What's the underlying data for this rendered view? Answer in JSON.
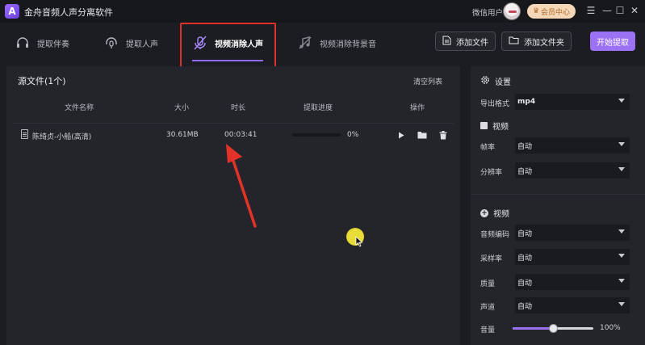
{
  "app": {
    "logo": "A",
    "title": "金舟音频人声分离软件",
    "user": "微信用户",
    "vip_label": "会员中心"
  },
  "window_controls": [
    "☰",
    "—",
    "☐",
    "✕"
  ],
  "tabs": [
    {
      "label": "提取伴奏",
      "icon": "headphones-icon"
    },
    {
      "label": "提取人声",
      "icon": "headphone-mic-icon"
    },
    {
      "label": "视频消除人声",
      "icon": "mute-mic-icon",
      "active": true
    },
    {
      "label": "视频消除背景音",
      "icon": "mute-music-icon"
    }
  ],
  "toolbar": {
    "add_file": "添加文件",
    "add_folder": "添加文件夹",
    "start": "开始提取"
  },
  "main": {
    "title": "源文件(1个)",
    "clear": "清空列表",
    "columns": {
      "name": "文件名称",
      "size": "大小",
      "duration": "时长",
      "progress": "提取进度",
      "actions": "操作"
    },
    "file": {
      "name": "陈绮贞-小船(高清)",
      "size": "30.61MB",
      "duration": "00:03:41",
      "progress_text": "0%",
      "progress": 0
    }
  },
  "settings": {
    "title": "设置",
    "export_format_label": "导出格式",
    "export_format": "mp4",
    "video_section": "视频",
    "frame_rate_label": "帧率",
    "frame_rate": "自动",
    "resolution_label": "分辨率",
    "resolution": "自动",
    "audio_section": "视频",
    "audio_codec_label": "音频编码",
    "audio_codec": "自动",
    "sample_rate_label": "采样率",
    "sample_rate": "自动",
    "quality_label": "质量",
    "quality": "自动",
    "channel_label": "声道",
    "channel": "自动",
    "volume_label": "音量",
    "volume_text": "100%",
    "volume": 0.5
  },
  "colors": {
    "accent": "#9c72f4",
    "annotation": "#e0302a",
    "background": "#1c1d22"
  }
}
